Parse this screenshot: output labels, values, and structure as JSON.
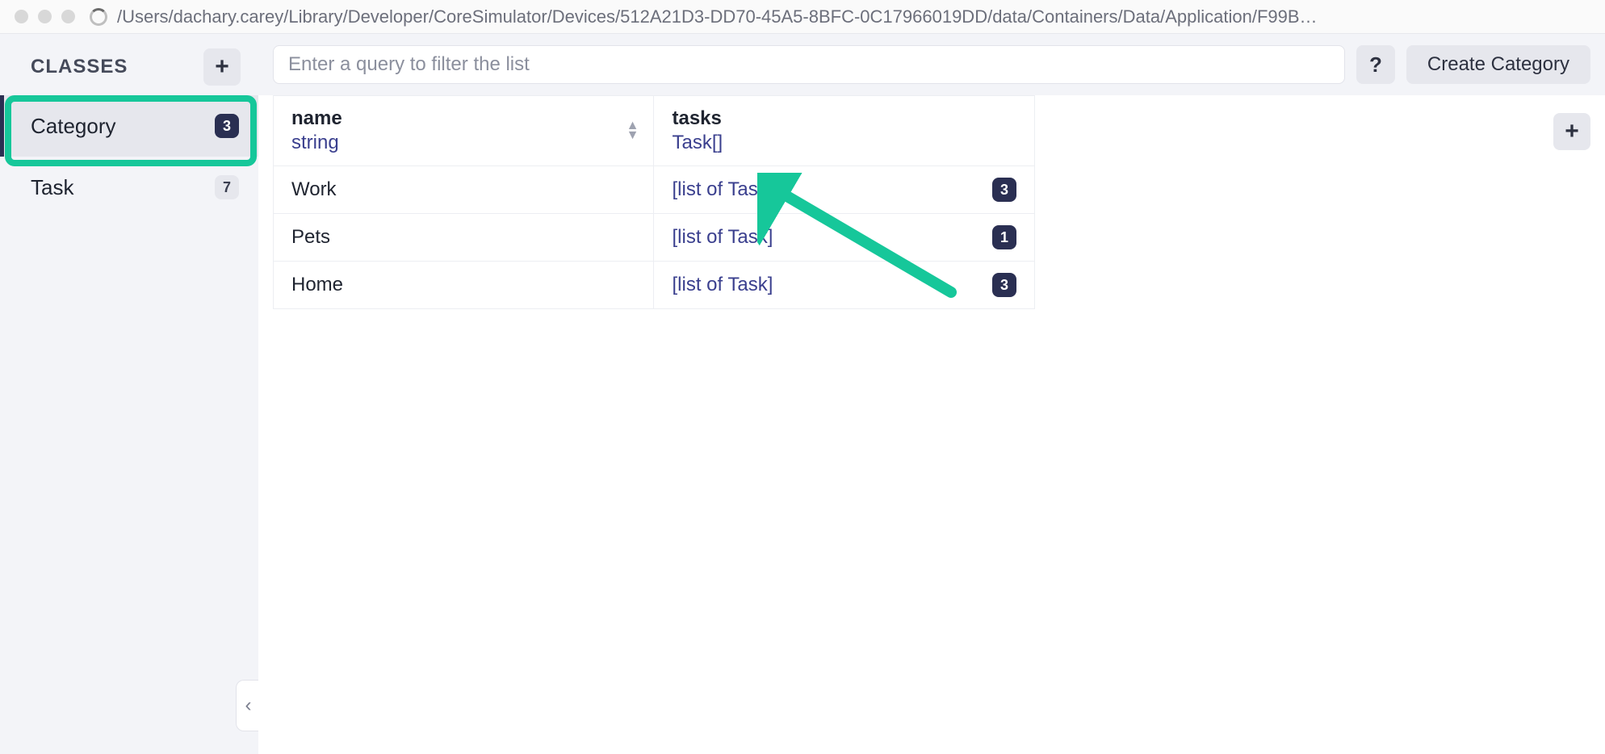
{
  "window": {
    "path": "/Users/dachary.carey/Library/Developer/CoreSimulator/Devices/512A21D3-DD70-45A5-8BFC-0C17966019DD/data/Containers/Data/Application/F99B…"
  },
  "sidebar": {
    "title": "CLASSES",
    "add_tooltip": "+",
    "items": [
      {
        "label": "Category",
        "count": "3",
        "active": true,
        "badge_style": "dark"
      },
      {
        "label": "Task",
        "count": "7",
        "active": false,
        "badge_style": "light"
      }
    ]
  },
  "toolbar": {
    "query_placeholder": "Enter a query to filter the list",
    "help_label": "?",
    "create_label": "Create Category"
  },
  "table": {
    "add_column_label": "+",
    "columns": [
      {
        "name": "name",
        "type": "string"
      },
      {
        "name": "tasks",
        "type": "Task[]"
      }
    ],
    "rows": [
      {
        "name": "Work",
        "tasks_label": "[list of Task]",
        "tasks_count": "3"
      },
      {
        "name": "Pets",
        "tasks_label": "[list of Task]",
        "tasks_count": "1"
      },
      {
        "name": "Home",
        "tasks_label": "[list of Task]",
        "tasks_count": "3"
      }
    ]
  },
  "annotation": {
    "highlight_color": "#16c79a"
  },
  "icons": {
    "plus": "+",
    "help": "?",
    "chevron_left": "‹"
  }
}
